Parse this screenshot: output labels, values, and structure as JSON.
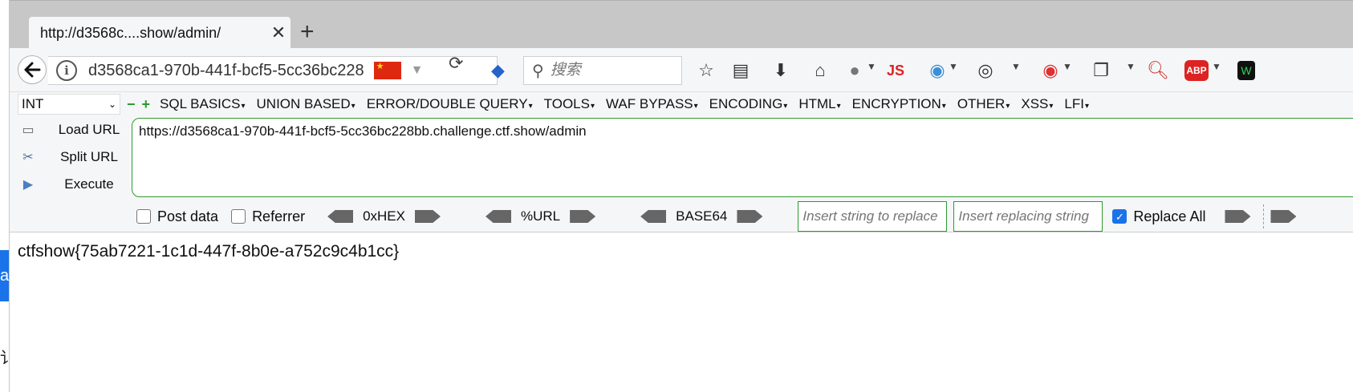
{
  "tab": {
    "title": "http://d3568c....show/admin/"
  },
  "nav": {
    "url_display": "d3568ca1-970b-441f-bcf5-5cc36bc228",
    "search_placeholder": "搜索",
    "js_label": "JS",
    "abp_label": "ABP"
  },
  "hackbar": {
    "select_value": "INT",
    "menu": [
      "SQL BASICS",
      "UNION BASED",
      "ERROR/DOUBLE QUERY",
      "TOOLS",
      "WAF BYPASS",
      "ENCODING",
      "HTML",
      "ENCRYPTION",
      "OTHER",
      "XSS",
      "LFI"
    ],
    "load_url": "Load URL",
    "split_url": "Split URL",
    "execute": "Execute",
    "url_value": "https://d3568ca1-970b-441f-bcf5-5cc36bc228bb.challenge.ctf.show/admin",
    "post_data": "Post data",
    "referrer": "Referrer",
    "hex": "0xHEX",
    "url_enc": "%URL",
    "base64": "BASE64",
    "replace_placeholder": "Insert string to replace",
    "replacing_placeholder": "Insert replacing string",
    "replace_all": "Replace All",
    "replace_all_checked": true
  },
  "page": {
    "flag": "ctfshow{75ab7221-1c1d-447f-8b0e-a752c9c4b1cc}"
  },
  "desktop": {
    "edge_char": "a",
    "edge_glyph": "讠"
  },
  "colors": {
    "accent_green": "#2f9a2f",
    "checkbox_blue": "#1a73e8",
    "flag_red": "#de2910"
  }
}
